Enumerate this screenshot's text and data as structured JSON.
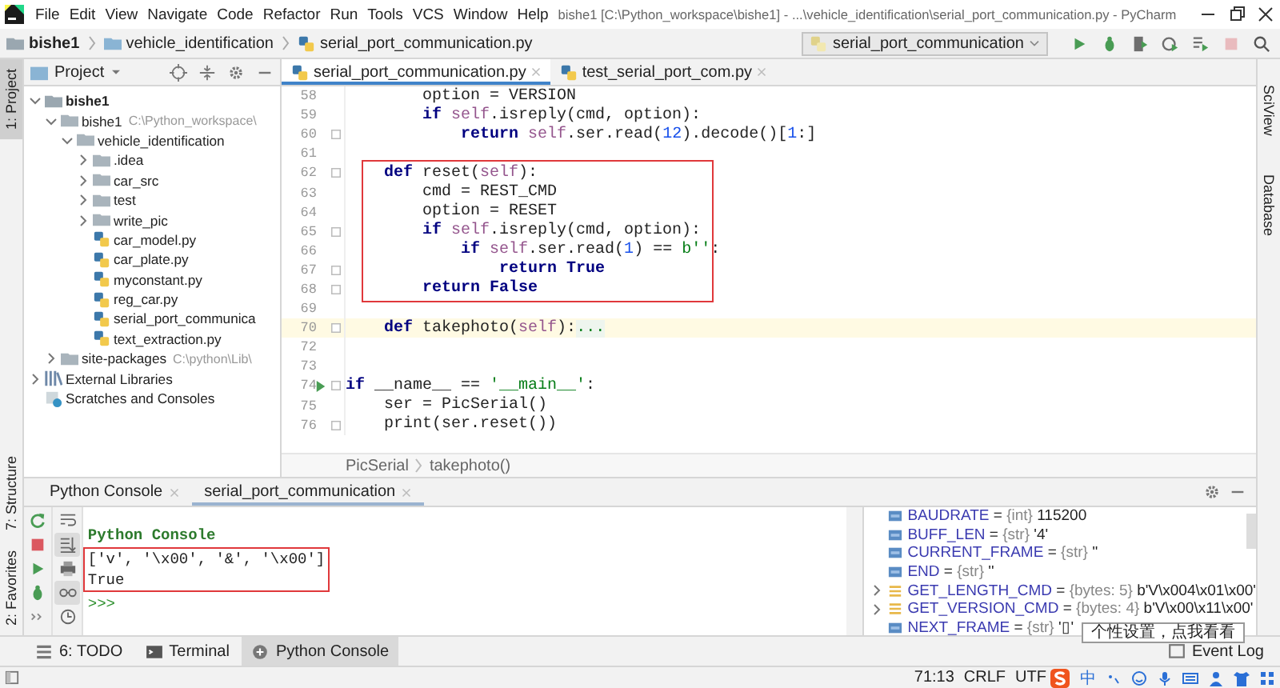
{
  "window": {
    "title": "bishe1 [C:\\Python_workspace\\bishe1] - ...\\vehicle_identification\\serial_port_communication.py - PyCharm"
  },
  "menu": [
    "File",
    "Edit",
    "View",
    "Navigate",
    "Code",
    "Refactor",
    "Run",
    "Tools",
    "VCS",
    "Window",
    "Help"
  ],
  "breadcrumb": [
    {
      "label": "bishe1",
      "kind": "project"
    },
    {
      "label": "vehicle_identification",
      "kind": "folder"
    },
    {
      "label": "serial_port_communication.py",
      "kind": "file"
    }
  ],
  "run_config": {
    "label": "serial_port_communication"
  },
  "toolbar": [
    {
      "kind": "run",
      "disabled": false
    },
    {
      "kind": "debug",
      "disabled": false
    },
    {
      "kind": "coverage",
      "disabled": false
    },
    {
      "kind": "profile",
      "disabled": false
    },
    {
      "kind": "concurrency",
      "disabled": false
    },
    {
      "kind": "stop",
      "disabled": true
    },
    {
      "kind": "search",
      "disabled": false
    }
  ],
  "left_stripe": {
    "top": [
      {
        "label": "1: Project",
        "selected": true
      }
    ],
    "bottom": [
      {
        "label": "7: Structure",
        "selected": false
      },
      {
        "label": "2: Favorites",
        "selected": false
      }
    ]
  },
  "right_stripe": [
    {
      "label": "SciView"
    },
    {
      "label": "Database"
    }
  ],
  "project": {
    "title": "Project",
    "tree": [
      {
        "label": "bishe1",
        "kind": "project",
        "expanded": true,
        "children": [
          {
            "label": "bishe1",
            "hint": "C:\\Python_workspace\\",
            "kind": "folder",
            "expanded": true,
            "children": [
              {
                "label": "vehicle_identification",
                "kind": "folder",
                "expanded": true,
                "children": [
                  {
                    "label": ".idea",
                    "kind": "folder",
                    "expanded": false
                  },
                  {
                    "label": "car_src",
                    "kind": "folder",
                    "expanded": false
                  },
                  {
                    "label": "test",
                    "kind": "folder",
                    "expanded": false
                  },
                  {
                    "label": "write_pic",
                    "kind": "folder",
                    "expanded": false
                  },
                  {
                    "label": "car_model.py",
                    "kind": "file"
                  },
                  {
                    "label": "car_plate.py",
                    "kind": "file"
                  },
                  {
                    "label": "myconstant.py",
                    "kind": "file"
                  },
                  {
                    "label": "reg_car.py",
                    "kind": "file"
                  },
                  {
                    "label": "serial_port_communica",
                    "kind": "file"
                  },
                  {
                    "label": "text_extraction.py",
                    "kind": "file"
                  }
                ]
              }
            ]
          },
          {
            "label": "site-packages",
            "hint": "C:\\python\\Lib\\",
            "kind": "folder",
            "expanded": false
          }
        ]
      },
      {
        "label": "External Libraries",
        "kind": "library",
        "expanded": false
      },
      {
        "label": "Scratches and Consoles",
        "kind": "scratches"
      }
    ]
  },
  "editor": {
    "tabs": [
      {
        "label": "serial_port_communication.py",
        "selected": true
      },
      {
        "label": "test_serial_port_com.py",
        "selected": false
      }
    ],
    "blocks": [
      {
        "boxed": false,
        "lines": [
          {
            "number": "58",
            "fold": false,
            "run": false,
            "current": false,
            "segments": [
              {
                "kind": "plain",
                "text": "        option = VERSION"
              }
            ]
          },
          {
            "number": "59",
            "fold": false,
            "run": false,
            "current": false,
            "segments": [
              {
                "kind": "kw",
                "text": "        if"
              },
              {
                "kind": "self",
                "text": " self"
              },
              {
                "kind": "plain",
                "text": ".isreply(cmd, option):"
              }
            ]
          },
          {
            "number": "60",
            "fold": true,
            "run": false,
            "current": false,
            "segments": [
              {
                "kind": "kw",
                "text": "            return"
              },
              {
                "kind": "self",
                "text": " self"
              },
              {
                "kind": "plain",
                "text": ".ser.read("
              },
              {
                "kind": "num",
                "text": "12"
              },
              {
                "kind": "plain",
                "text": ").decode()["
              },
              {
                "kind": "num",
                "text": "1"
              },
              {
                "kind": "plain",
                "text": ":]"
              }
            ]
          },
          {
            "number": "61",
            "fold": false,
            "run": false,
            "current": false
          }
        ]
      },
      {
        "boxed": true,
        "lines": [
          {
            "number": "62",
            "fold": true,
            "run": false,
            "current": false,
            "segments": [
              {
                "kind": "kw",
                "text": "    def"
              },
              {
                "kind": "plain",
                "text": " reset("
              },
              {
                "kind": "self",
                "text": "self"
              },
              {
                "kind": "plain",
                "text": "):"
              }
            ]
          },
          {
            "number": "63",
            "fold": false,
            "run": false,
            "current": false,
            "segments": [
              {
                "kind": "plain",
                "text": "        cmd = REST_CMD"
              }
            ]
          },
          {
            "number": "64",
            "fold": false,
            "run": false,
            "current": false,
            "segments": [
              {
                "kind": "plain",
                "text": "        option = RESET"
              }
            ]
          },
          {
            "number": "65",
            "fold": true,
            "run": false,
            "current": false,
            "segments": [
              {
                "kind": "kw",
                "text": "        if"
              },
              {
                "kind": "self",
                "text": " self"
              },
              {
                "kind": "plain",
                "text": ".isreply(cmd, option):"
              }
            ]
          },
          {
            "number": "66",
            "fold": false,
            "run": false,
            "current": false,
            "segments": [
              {
                "kind": "kw",
                "text": "            if"
              },
              {
                "kind": "self",
                "text": " self"
              },
              {
                "kind": "plain",
                "text": ".ser.read("
              },
              {
                "kind": "num",
                "text": "1"
              },
              {
                "kind": "plain",
                "text": ") == "
              },
              {
                "kind": "str",
                "text": "b''"
              },
              {
                "kind": "plain",
                "text": ":"
              }
            ]
          },
          {
            "number": "67",
            "fold": true,
            "run": false,
            "current": false,
            "segments": [
              {
                "kind": "kw",
                "text": "                return True"
              }
            ]
          },
          {
            "number": "68",
            "fold": true,
            "run": false,
            "current": false,
            "segments": [
              {
                "kind": "kw",
                "text": "        return False"
              }
            ]
          }
        ]
      },
      {
        "boxed": false,
        "lines": [
          {
            "number": "69",
            "fold": false,
            "run": false,
            "current": false
          },
          {
            "number": "70",
            "fold": true,
            "run": false,
            "current": true,
            "segments": [
              {
                "kind": "kw",
                "text": "    def"
              },
              {
                "kind": "plain",
                "text": " takephoto("
              },
              {
                "kind": "self",
                "text": "self"
              },
              {
                "kind": "plain",
                "text": "):"
              },
              {
                "kind": "folded",
                "text": "..."
              }
            ]
          },
          {
            "number": "72",
            "fold": false,
            "run": false,
            "current": false
          },
          {
            "number": "73",
            "fold": false,
            "run": false,
            "current": false
          },
          {
            "number": "74",
            "fold": true,
            "run": true,
            "current": false,
            "segments": [
              {
                "kind": "kw",
                "text": "if"
              },
              {
                "kind": "plain",
                "text": " __name__ == "
              },
              {
                "kind": "str",
                "text": "'__main__'"
              },
              {
                "kind": "plain",
                "text": ":"
              }
            ]
          },
          {
            "number": "75",
            "fold": false,
            "run": false,
            "current": false,
            "segments": [
              {
                "kind": "plain",
                "text": "    ser = PicSerial()"
              }
            ]
          },
          {
            "number": "76",
            "fold": true,
            "run": false,
            "current": false,
            "segments": [
              {
                "kind": "plain",
                "text": "    print(ser.reset())"
              }
            ]
          }
        ]
      }
    ],
    "breadcrumb": [
      "PicSerial",
      "takephoto()"
    ]
  },
  "console": {
    "tabs": [
      {
        "label": "Python Console",
        "selected": false
      },
      {
        "label": "serial_port_communication",
        "selected": true
      }
    ],
    "actions": [
      {
        "kind": "rerun"
      },
      {
        "kind": "stop"
      },
      {
        "kind": "run"
      },
      {
        "kind": "debug"
      },
      {
        "kind": "more"
      }
    ],
    "tools": [
      {
        "kind": "wrap",
        "on": false
      },
      {
        "kind": "scroll",
        "on": true
      },
      {
        "kind": "print",
        "on": false
      },
      {
        "kind": "glasses",
        "on": true
      },
      {
        "kind": "history",
        "on": false
      }
    ],
    "blocks": [
      {
        "boxed": false,
        "lines": [
          {
            "kind": "header",
            "text": "Python Console"
          }
        ]
      },
      {
        "boxed": true,
        "lines": [
          {
            "kind": "output",
            "text": "['v', '\\x00', '&', '\\x00']"
          },
          {
            "kind": "output",
            "text": "True"
          }
        ]
      },
      {
        "boxed": false,
        "lines": [
          {
            "kind": "prompt",
            "text": ">>>"
          }
        ]
      }
    ],
    "variables": [
      {
        "name": "BAUDRATE",
        "operator": "=",
        "type": "{int}",
        "value": "115200",
        "kind": "field"
      },
      {
        "name": "BUFF_LEN",
        "operator": "=",
        "type": "{str}",
        "value": "'4'",
        "kind": "field"
      },
      {
        "name": "CURRENT_FRAME",
        "operator": "=",
        "type": "{str}",
        "value": "''",
        "kind": "field"
      },
      {
        "name": "END",
        "operator": "=",
        "type": "{str}",
        "value": "''",
        "kind": "field"
      },
      {
        "name": "GET_LENGTH_CMD",
        "operator": "=",
        "type": "{bytes: 5}",
        "value": "b'V\\x004\\x01\\x00'",
        "kind": "bytes"
      },
      {
        "name": "GET_VERSION_CMD",
        "operator": "=",
        "type": "{bytes: 4}",
        "value": "b'V\\x00\\x11\\x00'",
        "kind": "bytes"
      },
      {
        "name": "NEXT_FRAME",
        "operator": "=",
        "type": "{str}",
        "value": "'▯'",
        "kind": "field"
      }
    ]
  },
  "tool_tabs": [
    {
      "label": "6: TODO",
      "kind": "todo",
      "selected": false
    },
    {
      "label": "Terminal",
      "kind": "terminal",
      "selected": false
    },
    {
      "label": "Python Console",
      "kind": "console",
      "selected": true
    }
  ],
  "event_log": "Event Log",
  "status_bar": {
    "position": "71:13",
    "line_ending": "CRLF",
    "encoding": "UTF",
    "ime": "中"
  },
  "tooltip": "个性设置，点我看看"
}
